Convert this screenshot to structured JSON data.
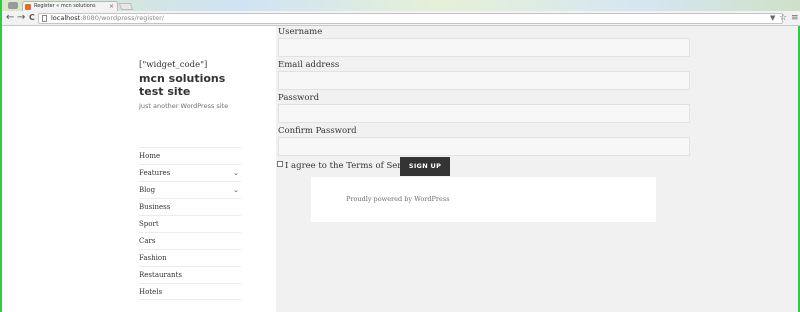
{
  "browser": {
    "tab_title": "Register « mcn solutions",
    "tab_close": "×",
    "url_host": "localhost",
    "url_path": ":8080/wordpress/register/",
    "back": "←",
    "forward": "→",
    "reload": "C",
    "bookmark_star": "☆",
    "tools": "▼",
    "menu": "≡"
  },
  "site": {
    "widget_code": "[\"widget_code\"]",
    "title": "mcn solutions test site",
    "tagline": "Just another WordPress site"
  },
  "nav": {
    "items": [
      {
        "label": "Home"
      },
      {
        "label": "Features",
        "chevron": "⌄"
      },
      {
        "label": "Blog",
        "chevron": "⌄"
      },
      {
        "label": "Business"
      },
      {
        "label": "Sport"
      },
      {
        "label": "Cars"
      },
      {
        "label": "Fashion"
      },
      {
        "label": "Restaurants"
      },
      {
        "label": "Hotels"
      }
    ]
  },
  "form": {
    "username_label": "Username",
    "username_value": "",
    "email_label": "Email address",
    "email_value": "",
    "password_label": "Password",
    "password_value": "",
    "confirm_label": "Confirm Password",
    "confirm_value": "",
    "agree_label": "I agree to the Terms of Service",
    "submit_label": "SIGN UP"
  },
  "footer": {
    "text": "Proudly powered by WordPress"
  },
  "colors": {
    "window_border": "#2ecc40",
    "content_bg": "#f1f1f1",
    "button_bg": "#333333"
  }
}
